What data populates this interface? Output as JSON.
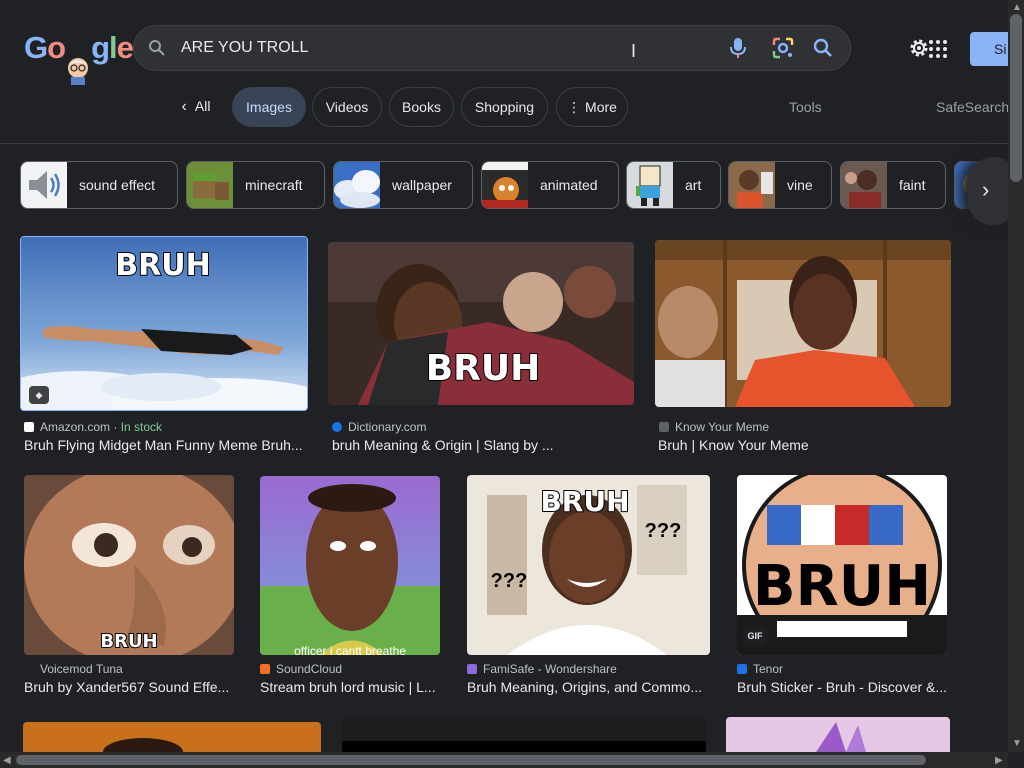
{
  "header": {
    "logo_text": [
      "G",
      "o",
      "o",
      "g",
      "l",
      "e"
    ],
    "search_query": "ARE YOU TROLL",
    "signin_label": "Si"
  },
  "tabs": {
    "all": "All",
    "images": "Images",
    "videos": "Videos",
    "books": "Books",
    "shopping": "Shopping",
    "more": "More",
    "tools": "Tools",
    "safesearch": "SafeSearch"
  },
  "chips": [
    {
      "label": "sound effect"
    },
    {
      "label": "minecraft"
    },
    {
      "label": "wallpaper"
    },
    {
      "label": "animated"
    },
    {
      "label": "art"
    },
    {
      "label": "vine"
    },
    {
      "label": "faint"
    }
  ],
  "results": [
    {
      "source": "Amazon.com",
      "stock": "In stock",
      "sep": " · ",
      "title": "Bruh Flying Midget Man Funny Meme Bruh...",
      "meme": "BRUH"
    },
    {
      "source": "Dictionary.com",
      "title": "bruh Meaning & Origin | Slang by ...",
      "meme": "BRUH"
    },
    {
      "source": "Know Your Meme",
      "title": "Bruh | Know Your Meme"
    },
    {
      "source": "Voicemod Tuna",
      "title": "Bruh by Xander567 Sound Effe...",
      "meme": "BRUH"
    },
    {
      "source": "SoundCloud",
      "title": "Stream bruh lord music | L...",
      "caption": "officer i cantt breathe"
    },
    {
      "source": "FamiSafe - Wondershare",
      "title": "Bruh Meaning, Origins, and Commo...",
      "meme": "BRUH",
      "q1": "???",
      "q2": "???"
    },
    {
      "source": "Tenor",
      "title": "Bruh Sticker - Bruh - Discover &...",
      "meme": "BRUH",
      "badge": "GIF"
    }
  ],
  "colors": {
    "background": "#202124",
    "accent": "#8ab4f8",
    "active_tab": "#394457",
    "in_stock": "#81c995"
  }
}
